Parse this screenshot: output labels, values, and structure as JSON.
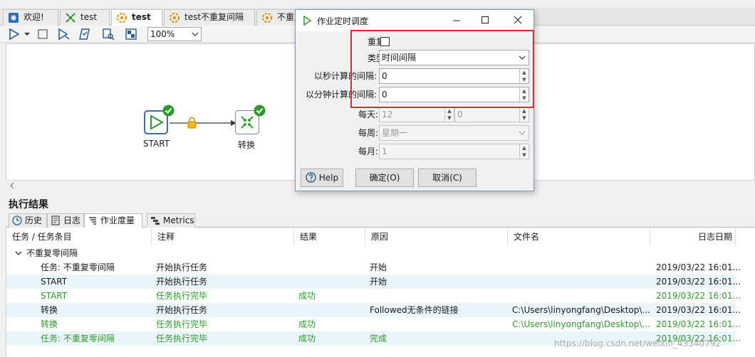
{
  "tabs": [
    {
      "label": "欢迎!",
      "icon": "spoon-icon"
    },
    {
      "label": "test",
      "icon": "transformation-icon"
    },
    {
      "label": "test",
      "icon": "job-icon",
      "active": true
    },
    {
      "label": "test不重复间隔",
      "icon": "job-icon"
    },
    {
      "label": "不重复",
      "icon": "job-icon"
    }
  ],
  "toolbar": {
    "zoom": "100%",
    "icons": [
      "run-icon",
      "run-options-icon",
      "stop-icon",
      "preview-icon",
      "check-icon",
      "impact-icon",
      "sql-icon"
    ]
  },
  "canvas": {
    "start_label": "START",
    "transform_label": "转换"
  },
  "results": {
    "title": "执行结果",
    "tabs": [
      "历史",
      "日志",
      "作业度量",
      "Metrics"
    ],
    "columns": [
      "任务 / 任务条目",
      "注释",
      "结果",
      "原因",
      "文件名",
      "日志日期"
    ],
    "group": "不重复零间隔",
    "rows": [
      {
        "task": "任务: 不重复零间隔",
        "comment": "开始执行任务",
        "result": "",
        "reason": "开始",
        "file": "",
        "date": "2019/03/22 16:01...",
        "green": false
      },
      {
        "task": "START",
        "comment": "开始执行任务",
        "result": "",
        "reason": "开始",
        "file": "",
        "date": "2019/03/22 16:01...",
        "green": false
      },
      {
        "task": "START",
        "comment": "任务执行完毕",
        "result": "成功",
        "reason": "",
        "file": "",
        "date": "2019/03/22 16:01...",
        "green": true
      },
      {
        "task": "转换",
        "comment": "开始执行任务",
        "result": "",
        "reason": "Followed无条件的链接",
        "file": "C:\\Users\\linyongfang\\Desktop\\...",
        "date": "2019/03/22 16:01...",
        "green": false
      },
      {
        "task": "转换",
        "comment": "任务执行完毕",
        "result": "成功",
        "reason": "",
        "file": "C:\\Users\\linyongfang\\Desktop\\...",
        "date": "2019/03/22 16:01...",
        "green": true
      },
      {
        "task": "任务: 不重复零间隔",
        "comment": "任务执行完毕",
        "result": "成功",
        "reason": "完成",
        "file": "",
        "date": "2019/03/22 16:01...",
        "green": true
      }
    ]
  },
  "dialog": {
    "title": "作业定时调度",
    "fields": {
      "repeat_label": "重复:",
      "type_label": "类型:",
      "type_value": "时间间隔",
      "seconds_label": "以秒计算的间隔:",
      "seconds_value": "0",
      "minutes_label": "以分钟计算的间隔:",
      "minutes_value": "0",
      "daily_label": "每天:",
      "daily_hour": "12",
      "daily_minute": "0",
      "weekly_label": "每周:",
      "weekly_value": "星期一",
      "monthly_label": "每月:",
      "monthly_value": "1"
    },
    "buttons": {
      "help": "Help",
      "ok": "确定(O)",
      "cancel": "取消(C)"
    }
  },
  "watermark": "https://blog.csdn.net/weixin_43340792",
  "colors": {
    "highlight": "#e0282e",
    "success_text": "#2e9a2e",
    "row_alt": "#e9f4fb"
  }
}
